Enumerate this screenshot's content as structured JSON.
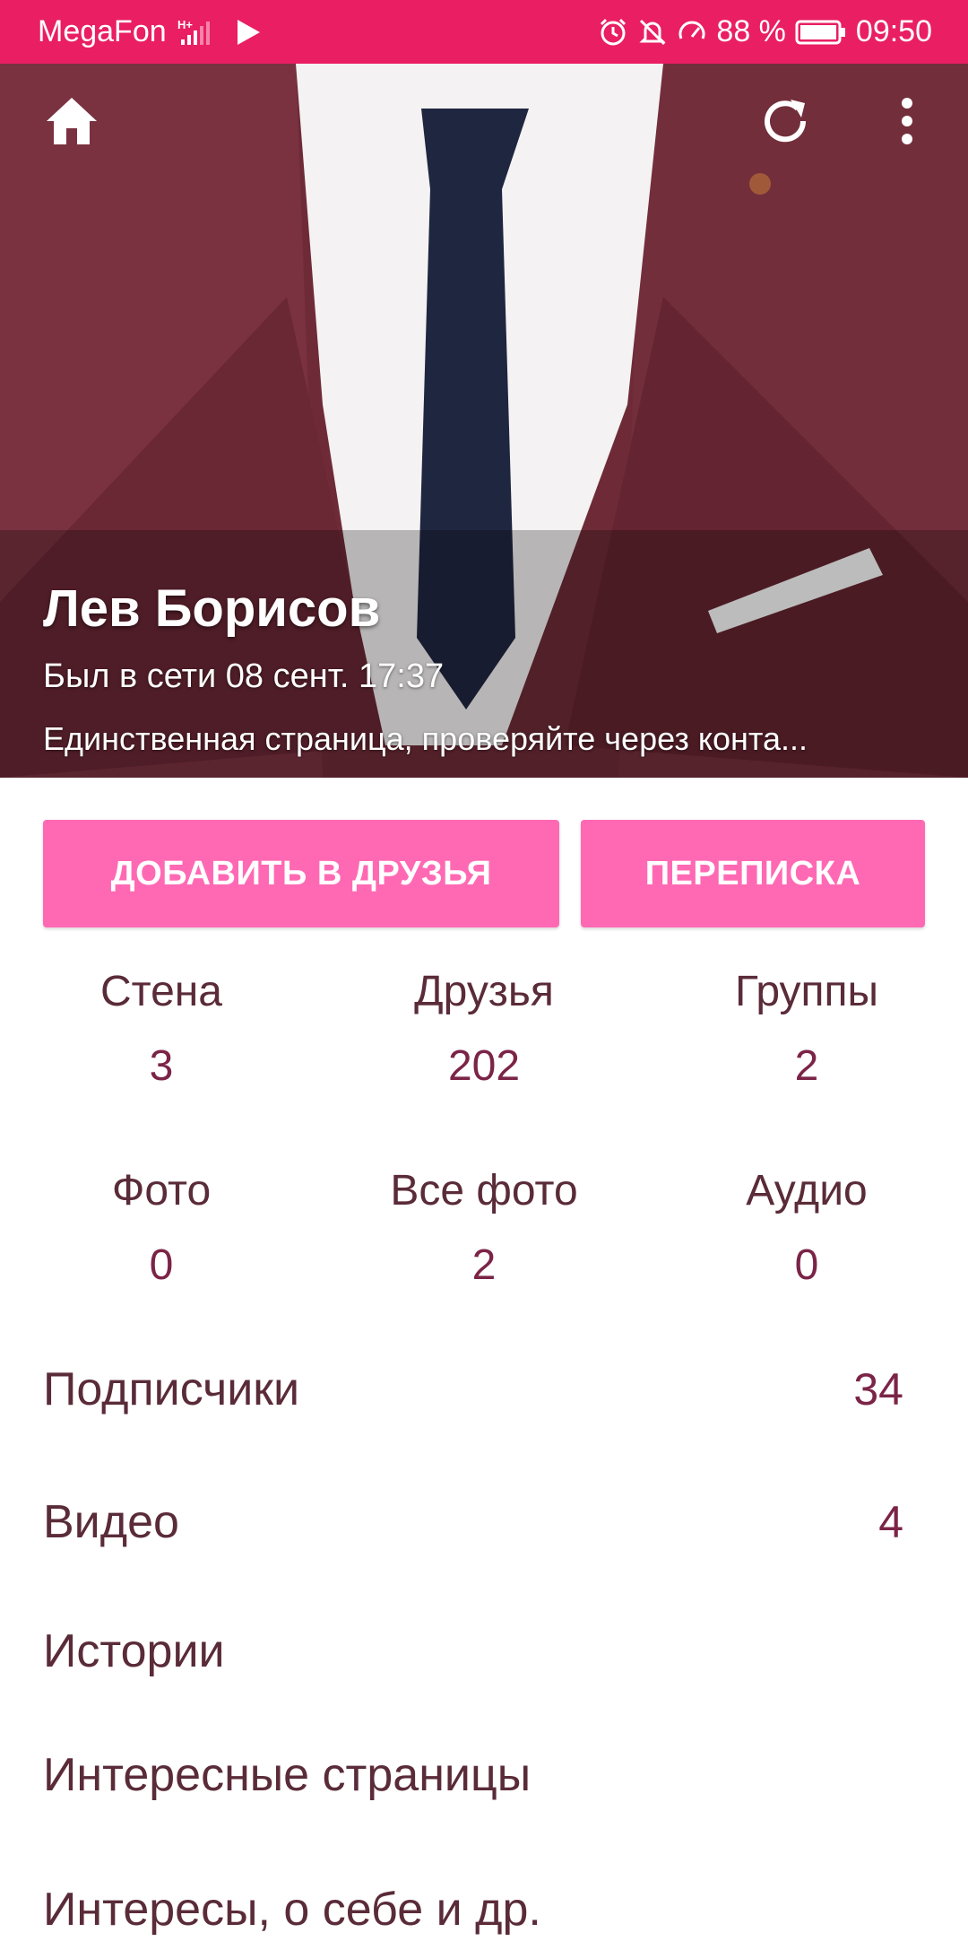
{
  "status_bar": {
    "carrier": "MegaFon",
    "network": "H+",
    "battery": "88 %",
    "time": "09:50",
    "icons": [
      "signal-icon",
      "play-icon",
      "alarm-icon",
      "mute-icon",
      "data-saver-icon",
      "battery-icon"
    ]
  },
  "toolbar": {
    "home_icon": "home-icon",
    "refresh_icon": "refresh-icon",
    "more_icon": "more-vert-icon"
  },
  "profile": {
    "name": "Лев Борисов",
    "last_seen": "Был в сети 08 сент. 17:37",
    "status": "Единственная страница, проверяйте через конта..."
  },
  "actions": {
    "add_friend": "ДОБАВИТЬ В ДРУЗЬЯ",
    "messages": "ПЕРЕПИСКА"
  },
  "counters": [
    {
      "label": "Стена",
      "value": "3"
    },
    {
      "label": "Друзья",
      "value": "202"
    },
    {
      "label": "Группы",
      "value": "2"
    },
    {
      "label": "Фото",
      "value": "0"
    },
    {
      "label": "Все фото",
      "value": "2"
    },
    {
      "label": "Аудио",
      "value": "0"
    }
  ],
  "rows": [
    {
      "label": "Подписчики",
      "value": "34"
    },
    {
      "label": "Видео",
      "value": "4"
    },
    {
      "label": "Истории",
      "value": ""
    },
    {
      "label": "Интересные страницы",
      "value": ""
    },
    {
      "label": "Интересы, о себе и др.",
      "value": ""
    }
  ],
  "colors": {
    "status_bar": "#E91E63",
    "button": "#FF69B4",
    "value_text": "#7b2447",
    "label_text": "#5a2b38"
  }
}
